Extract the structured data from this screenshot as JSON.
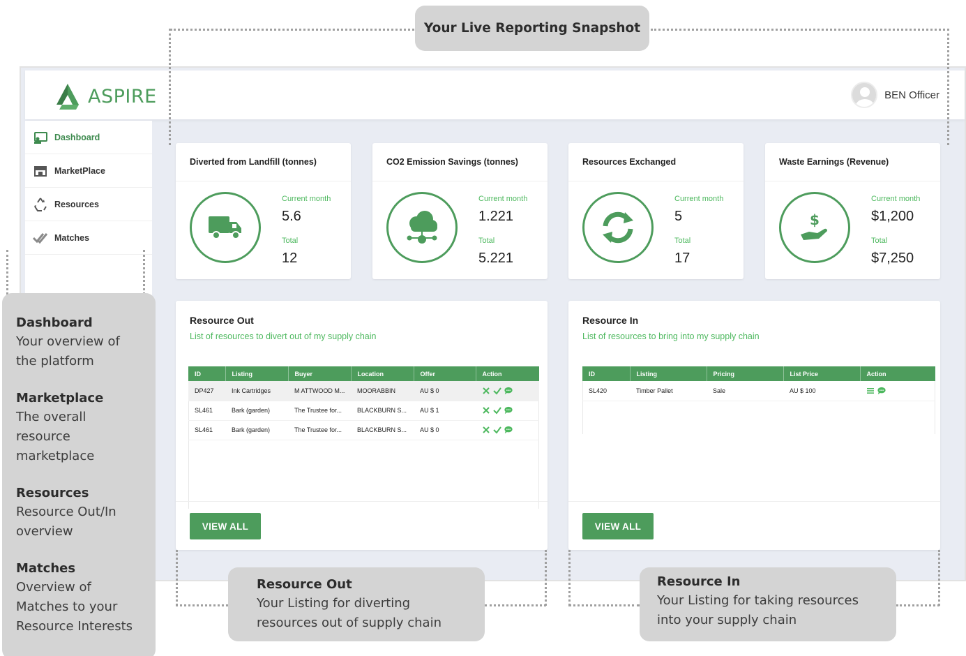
{
  "app": {
    "brand": "ASPIRE",
    "user_name": "BEN Officer",
    "colors": {
      "primary": "#4d9c5c",
      "accent_text": "#4db85e",
      "background": "#e9ecf3"
    }
  },
  "sidebar": {
    "items": [
      {
        "label": "Dashboard",
        "icon": "dashboard-icon"
      },
      {
        "label": "MarketPlace",
        "icon": "store-icon"
      },
      {
        "label": "Resources",
        "icon": "recycle-icon"
      },
      {
        "label": "Matches",
        "icon": "double-check-icon"
      }
    ]
  },
  "stats": [
    {
      "title": "Diverted from Landfill (tonnes)",
      "icon": "truck-icon",
      "current_label": "Current month",
      "current_value": "5.6",
      "total_label": "Total",
      "total_value": "12"
    },
    {
      "title": "CO2 Emission Savings (tonnes)",
      "icon": "cloud-network-icon",
      "current_label": "Current month",
      "current_value": "1.221",
      "total_label": "Total",
      "total_value": "5.221"
    },
    {
      "title": "Resources Exchanged",
      "icon": "sync-icon",
      "current_label": "Current month",
      "current_value": "5",
      "total_label": "Total",
      "total_value": "17"
    },
    {
      "title": "Waste Earnings (Revenue)",
      "icon": "hand-dollar-icon",
      "current_label": "Current month",
      "current_value": "$1,200",
      "total_label": "Total",
      "total_value": "$7,250"
    }
  ],
  "resource_out": {
    "title": "Resource Out",
    "description": "List of resources to divert out of my supply chain",
    "columns": [
      "ID",
      "Listing",
      "Buyer",
      "Location",
      "Offer",
      "Action"
    ],
    "rows": [
      {
        "id": "DP427",
        "listing": "Ink Cartridges",
        "buyer": "M ATTWOOD M...",
        "location": "MOORABBIN",
        "offer": "AU $ 0"
      },
      {
        "id": "SL461",
        "listing": "Bark (garden)",
        "buyer": "The Trustee for...",
        "location": "BLACKBURN S...",
        "offer": "AU $ 1"
      },
      {
        "id": "SL461",
        "listing": "Bark (garden)",
        "buyer": "The Trustee for...",
        "location": "BLACKBURN S...",
        "offer": "AU $ 0"
      }
    ],
    "button": "VIEW ALL"
  },
  "resource_in": {
    "title": "Resource In",
    "description": "List of resources to bring into my supply chain",
    "columns": [
      "ID",
      "Listing",
      "Pricing",
      "List Price",
      "Action"
    ],
    "rows": [
      {
        "id": "SL420",
        "listing": "Timber Pallet",
        "pricing": "Sale",
        "list_price": "AU $ 100"
      }
    ],
    "button": "VIEW ALL"
  },
  "annotations": {
    "snapshot": "Your Live Reporting Snapshot",
    "left_groups": [
      {
        "heading": "Dashboard",
        "lines": [
          "Your overview of",
          "the platform"
        ]
      },
      {
        "heading": "Marketplace",
        "lines": [
          "The overall",
          "resource",
          "marketplace"
        ]
      },
      {
        "heading": "Resources",
        "lines": [
          "Resource Out/In",
          "overview"
        ]
      },
      {
        "heading": "Matches",
        "lines": [
          "Overview of",
          "Matches to your",
          "Resource Interests"
        ]
      }
    ],
    "resource_out": {
      "heading": "Resource Out",
      "lines": [
        "Your Listing for diverting",
        "resources out of supply chain"
      ]
    },
    "resource_in": {
      "heading": "Resource In",
      "lines": [
        "Your Listing for taking resources",
        "into your supply chain"
      ]
    }
  }
}
